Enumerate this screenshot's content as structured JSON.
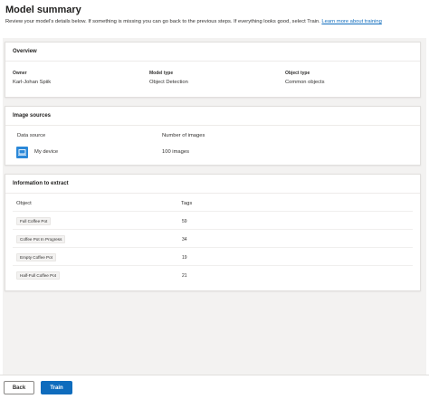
{
  "page": {
    "title": "Model summary",
    "intro_text": "Review your model's details below. If something is missing you can go back to the previous steps. If everything looks good, select Train. ",
    "intro_link": "Learn more about training"
  },
  "overview": {
    "heading": "Overview",
    "owner_label": "Owner",
    "owner_value": "Karl-Johan Spiik",
    "model_type_label": "Model type",
    "model_type_value": "Object Detection",
    "object_type_label": "Object type",
    "object_type_value": "Common objects"
  },
  "image_sources": {
    "heading": "Image sources",
    "col_source": "Data source",
    "col_count": "Number of images",
    "rows": [
      {
        "source": "My device",
        "icon": "laptop-icon",
        "count": "100 images"
      }
    ]
  },
  "extract": {
    "heading": "Information to extract",
    "col_object": "Object",
    "col_tags": "Tags",
    "rows": [
      {
        "object": "Full Coffee Pot",
        "tags": "59"
      },
      {
        "object": "Coffee Pot In Progress",
        "tags": "34"
      },
      {
        "object": "Empty Coffee Pot",
        "tags": "19"
      },
      {
        "object": "Half-Full Coffee Pot",
        "tags": "21"
      }
    ]
  },
  "footer": {
    "back_label": "Back",
    "train_label": "Train"
  },
  "colors": {
    "accent": "#0f6cbd",
    "device_icon": "#2b88d8",
    "content_bg": "#f3f2f1"
  }
}
